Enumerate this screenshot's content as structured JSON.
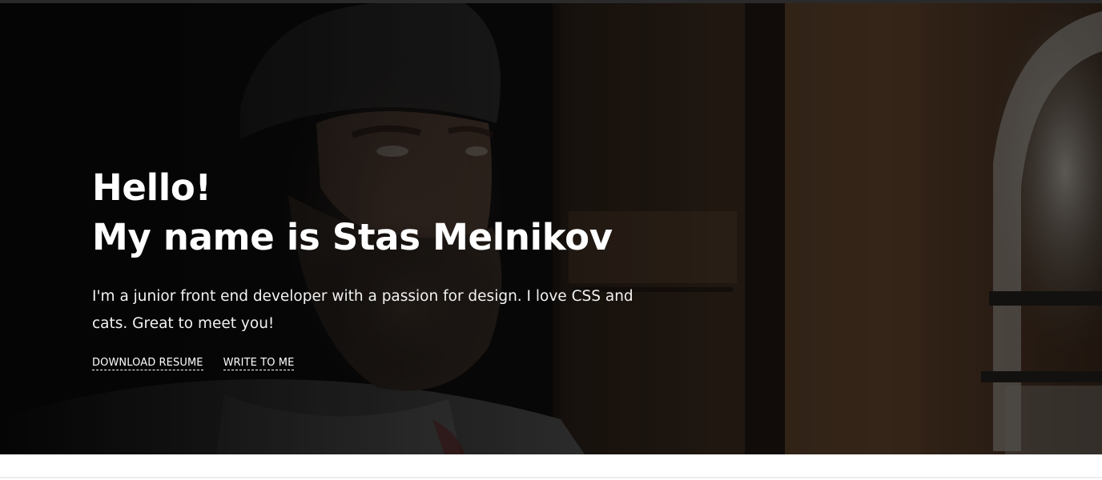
{
  "hero": {
    "greeting": "Hello!",
    "name_line": "My name is Stas Melnikov",
    "intro": "I'm a junior front end developer with a passion for design. I love CSS and cats. Great to meet you!",
    "links": {
      "download_resume": "DOWNLOAD RESUME",
      "write_to_me": "WRITE TO ME"
    }
  },
  "colors": {
    "hero_overlay": "#0b0b0c",
    "text": "#ffffff",
    "page_background": "#ffffff"
  }
}
